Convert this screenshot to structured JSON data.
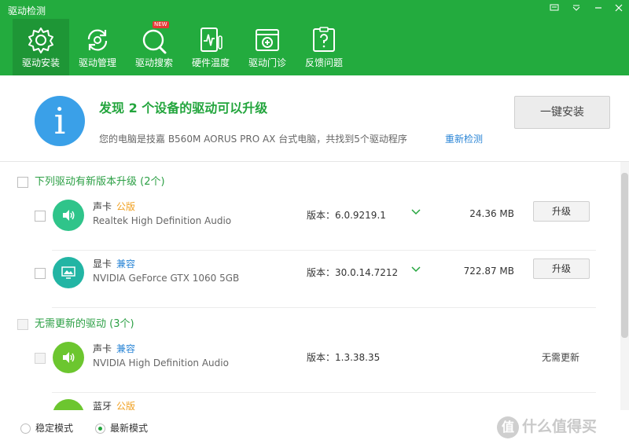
{
  "window": {
    "title": "驱动检测"
  },
  "nav": [
    {
      "label": "驱动安装",
      "icon": "gear-icon"
    },
    {
      "label": "驱动管理",
      "icon": "refresh-icon"
    },
    {
      "label": "驱动搜索",
      "icon": "search-icon",
      "badge": "NEW"
    },
    {
      "label": "硬件温度",
      "icon": "thermometer-icon"
    },
    {
      "label": "驱动门诊",
      "icon": "clinic-icon"
    },
    {
      "label": "反馈问题",
      "icon": "feedback-icon"
    }
  ],
  "banner": {
    "headline": "发现 2 个设备的驱动可以升级",
    "subline": "您的电脑是技嘉 B560M AORUS PRO AX 台式电脑，共找到5个驱动程序",
    "rescan": "重新检测",
    "install_button": "一键安装"
  },
  "sections": [
    {
      "title": "下列驱动有新版本升级 (2个)",
      "rows": [
        {
          "type": "声卡",
          "tag": "公版",
          "name": "Realtek High Definition Audio",
          "version": "版本：6.0.9219.1",
          "size": "24.36 MB",
          "action": "升级"
        },
        {
          "type": "显卡",
          "tag": "兼容",
          "name": "NVIDIA GeForce GTX 1060 5GB",
          "version": "版本：30.0.14.7212",
          "size": "722.87 MB",
          "action": "升级"
        }
      ]
    },
    {
      "title": "无需更新的驱动 (3个)",
      "rows": [
        {
          "type": "声卡",
          "tag": "兼容",
          "name": "NVIDIA High Definition Audio",
          "version": "版本：1.3.38.35",
          "status": "无需更新"
        },
        {
          "type": "蓝牙",
          "tag": "公版"
        }
      ]
    }
  ],
  "footer": {
    "mode_stable": "稳定模式",
    "mode_latest": "最新模式",
    "watermark": "什么值得买",
    "watermark_mark": "值"
  },
  "colors": {
    "header_green": "#23ab3e",
    "accent_green": "#23a53d",
    "info_blue": "#3aa0e8",
    "audio_icon": "#2fc48a",
    "display_icon": "#22b5a4",
    "nochange_icon": "#6cc62f"
  }
}
